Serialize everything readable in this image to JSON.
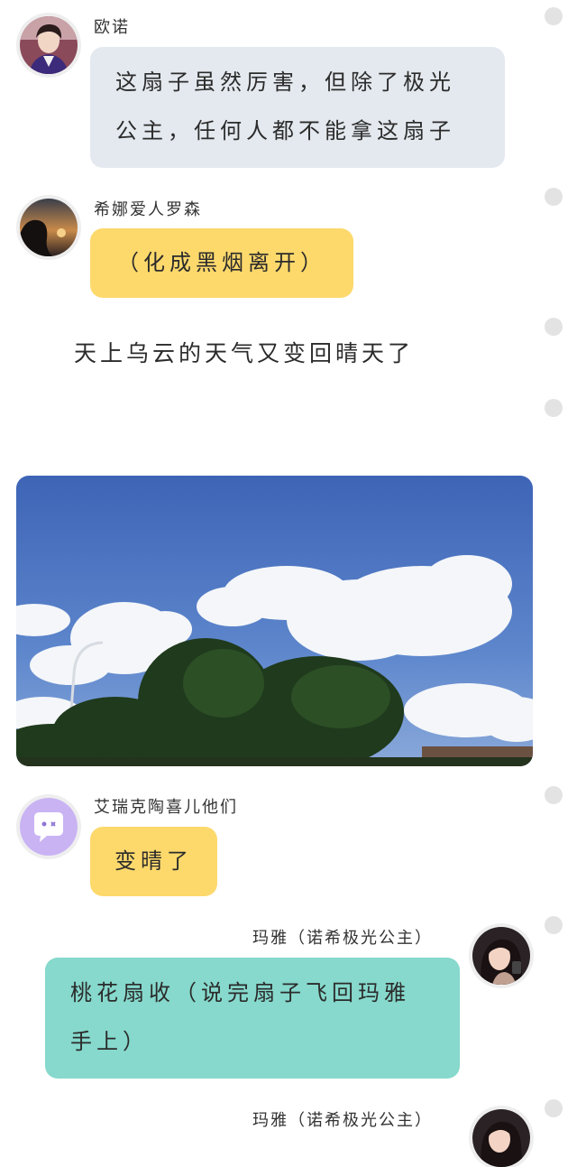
{
  "messages": [
    {
      "sender": "欧诺",
      "avatar_icon": "boy-portrait-icon",
      "bubble_color": "#e4e9ef",
      "lines": [
        "这扇子虽然厉害，但除了极光",
        "公主，任何人都不能拿这扇子"
      ]
    },
    {
      "sender": "希娜爱人罗森",
      "avatar_icon": "silhouette-portrait-icon",
      "bubble_color": "#fdd96c",
      "text": "（化成黑烟离开）"
    },
    {
      "narration": "天上乌云的天气又变回晴天了"
    },
    {
      "image": "sky-clouds-trees-photo"
    },
    {
      "sender": "艾瑞克陶喜儿他们",
      "avatar_icon": "chat-bubble-face-icon",
      "bubble_color": "#fdd96c",
      "text": "变晴了"
    },
    {
      "sender": "玛雅（诺希极光公主）",
      "avatar_icon": "girl-portrait-icon",
      "bubble_color": "#86d9cc",
      "lines": [
        "桃花扇收（说完扇子飞回玛雅",
        "手上）"
      ]
    },
    {
      "sender": "玛雅（诺希极光公主）",
      "avatar_icon": "girl-portrait-icon"
    }
  ]
}
